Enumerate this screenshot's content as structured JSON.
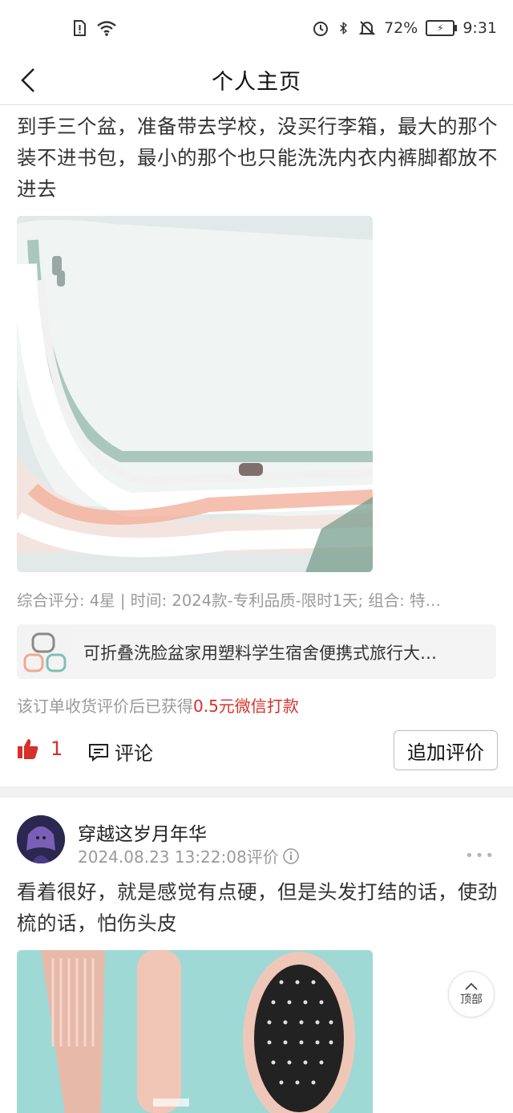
{
  "status_bar": {
    "battery": "72%",
    "time": "9:31"
  },
  "nav": {
    "title": "个人主页"
  },
  "review1": {
    "text": "到手三个盆，准备带去学校，没买行李箱，最大的那个装不进书包，最小的那个也只能洗洗内衣内裤脚都放不进去",
    "meta": "综合评分: 4星 | 时间: 2024款-专利品质-限时1天; 组合: 特…",
    "product_title": "可折叠洗脸盆家用塑料学生宿舍便携式旅行大…",
    "reward_prefix": "该订单收货评价后已获得",
    "reward_amount": "0.5元微信打款",
    "like_count": "1",
    "comment_label": "评论",
    "add_review_label": "追加评价"
  },
  "review2": {
    "username": "穿越这岁月年华",
    "timestamp": "2024.08.23 13:22:08评价",
    "text": "看着很好，就是感觉有点硬，但是头发打结的话，使劲梳的话，怕伤头皮",
    "more": "•••"
  },
  "top_button": {
    "label": "顶部"
  },
  "colors": {
    "accent_red": "#d6302a"
  }
}
